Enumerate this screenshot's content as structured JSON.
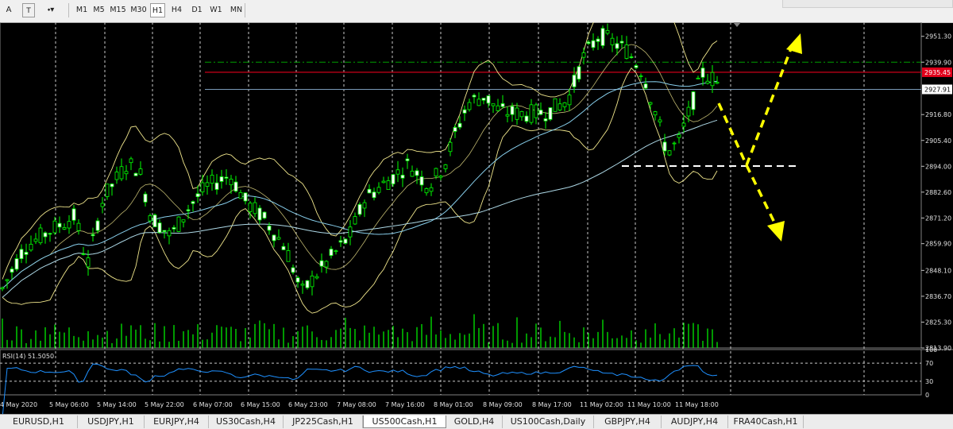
{
  "toolbar": {
    "tools": [
      {
        "name": "text-tool-icon",
        "label": "A"
      },
      {
        "name": "text-label-tool-icon",
        "label": "T"
      },
      {
        "name": "arrows-tool-icon",
        "label": "⬩▾"
      }
    ],
    "timeframes": [
      "M1",
      "M5",
      "M15",
      "M30",
      "H1",
      "H4",
      "D1",
      "W1",
      "MN"
    ],
    "active_timeframe": "H1"
  },
  "main_chart": {
    "price_axis": [
      "2951.30",
      "2939.90",
      "2916.80",
      "2905.40",
      "2894.00",
      "2882.60",
      "2871.20",
      "2859.90",
      "2848.10",
      "2836.70",
      "2825.30",
      "2813.90"
    ],
    "current_price": "2927.91",
    "red_line_price": "2935.45",
    "price_range": [
      2813.9,
      2957.5
    ]
  },
  "rsi": {
    "label": "RSI(14) 51.5050",
    "levels": [
      "100",
      "70",
      "30",
      "0"
    ]
  },
  "time_axis": [
    "4 May 2020",
    "5 May 06:00",
    "5 May 14:00",
    "5 May 22:00",
    "6 May 07:00",
    "6 May 15:00",
    "6 May 23:00",
    "7 May 08:00",
    "7 May 16:00",
    "8 May 01:00",
    "8 May 09:00",
    "8 May 17:00",
    "11 May 02:00",
    "11 May 10:00",
    "11 May 18:00"
  ],
  "symbol_tabs": [
    "EURUSD,H1",
    "USDJPY,H1",
    "EURJPY,H4",
    "US30Cash,H4",
    "JP225Cash,H1",
    "US500Cash,H1",
    "GOLD,H4",
    "US100Cash,Daily",
    "GBPJPY,H4",
    "AUDJPY,H4",
    "FRA40Cash,H1"
  ],
  "active_tab": "US500Cash,H1",
  "colors": {
    "candle": "#00ff00",
    "fast_ma": "#87ceeb",
    "slow_ma": "#add8e6",
    "bollinger": "#f0e68c",
    "rsi_line": "#1e90ff",
    "resistance_line": "#e0001b",
    "dash_dot_line": "#00a000",
    "annotation": "#ffff00",
    "support_dash": "#ffffff"
  }
}
